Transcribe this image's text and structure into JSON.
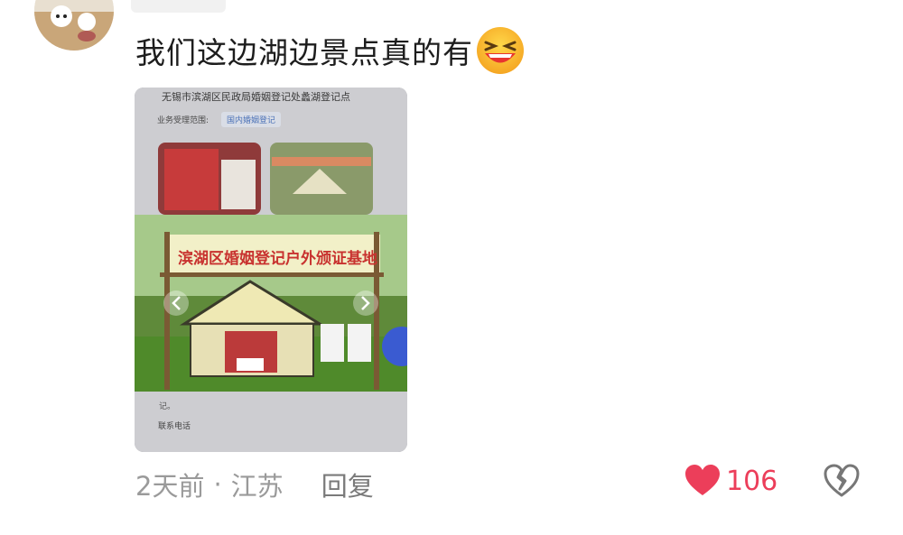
{
  "comment": {
    "text": "我们这边湖边景点真的有",
    "emoji": "laughing-face-emoji"
  },
  "photo": {
    "title": "无锡市滨湖区民政局婚姻登记处蠡湖登记点",
    "scope_label": "业务受理范围:",
    "scope_chip": "国内婚姻登记",
    "banner": "滨湖区婚姻登记户外颁证基地",
    "tail_text": "记。",
    "phone_label": "联系电话"
  },
  "meta": {
    "time": "2天前",
    "separator": "·",
    "location": "江苏",
    "reply": "回复"
  },
  "actions": {
    "like_count": "106",
    "like_color": "#ec3e5a"
  }
}
